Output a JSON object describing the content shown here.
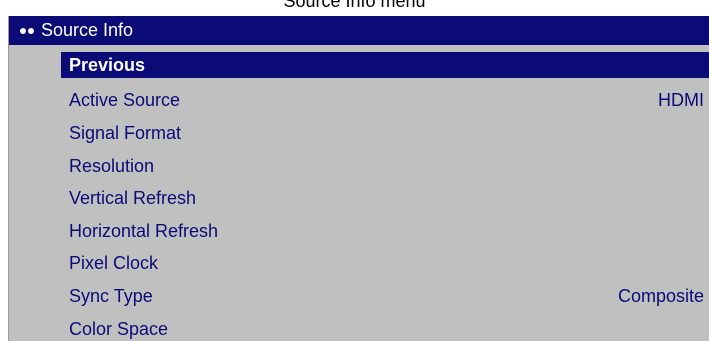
{
  "page": {
    "caption": "Source Info menu"
  },
  "menu": {
    "header_dots_icon": "two-dots",
    "title": "Source Info",
    "colors": {
      "panel_bg": "#c0c0c0",
      "header_bg": "#0b0b78",
      "header_text": "#ffffff",
      "item_text": "#0b0b78",
      "selection_bg": "#0b0b78"
    },
    "items": [
      {
        "label": "Previous",
        "value": "",
        "selected": true
      },
      {
        "label": "Active Source",
        "value": "HDMI",
        "selected": false
      },
      {
        "label": "Signal Format",
        "value": "",
        "selected": false
      },
      {
        "label": "Resolution",
        "value": "",
        "selected": false
      },
      {
        "label": "Vertical Refresh",
        "value": "",
        "selected": false
      },
      {
        "label": "Horizontal Refresh",
        "value": "",
        "selected": false
      },
      {
        "label": "Pixel Clock",
        "value": "",
        "selected": false
      },
      {
        "label": "Sync Type",
        "value": "Composite",
        "selected": false
      },
      {
        "label": "Color Space",
        "value": "",
        "selected": false
      }
    ]
  }
}
